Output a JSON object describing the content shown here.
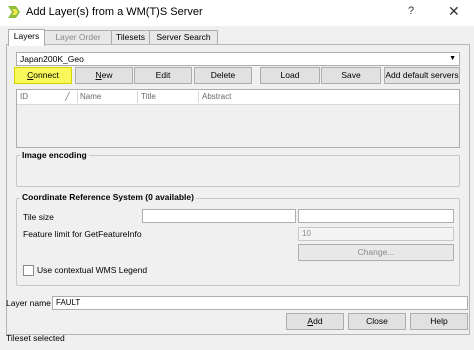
{
  "window": {
    "title": "Add Layer(s) from a WM(T)S Server",
    "help_symbol": "?",
    "close_symbol": "✕"
  },
  "tabs": [
    {
      "label": "Layers",
      "state": "active"
    },
    {
      "label": "Layer Order",
      "state": "disabled"
    },
    {
      "label": "Tilesets",
      "state": "normal"
    },
    {
      "label": "Server Search",
      "state": "normal"
    }
  ],
  "connection": {
    "selected": "Japan200K_Geo",
    "arrow": "▼"
  },
  "connection_buttons": {
    "connect_first": "C",
    "connect_rest": "onnect",
    "new_first": "N",
    "new_rest": "ew",
    "edit": "Edit",
    "delete": "Delete",
    "load": "Load",
    "save": "Save",
    "add_default": "Add default servers"
  },
  "table": {
    "columns": [
      "ID",
      "Name",
      "Title",
      "Abstract"
    ],
    "sort_indicator": "╱"
  },
  "image_encoding": {
    "title": "Image encoding"
  },
  "crs": {
    "title": "Coordinate Reference System (0 available)",
    "tile_size_label": "Tile size",
    "tile_width": "",
    "tile_height": "",
    "feature_limit_label": "Feature limit for GetFeatureInfo",
    "feature_limit_value": "10",
    "change_button": "Change..."
  },
  "contextual_legend": {
    "label": "Use contextual WMS Legend",
    "checked": false
  },
  "layer_name": {
    "label": "Layer name",
    "value": "FAULT"
  },
  "footer": {
    "add_first": "A",
    "add_rest": "dd",
    "close": "Close",
    "help": "Help",
    "status": "Tileset selected"
  },
  "colors": {
    "connect_highlight": "#f8f85a",
    "window_bg": "#f0f0f0"
  }
}
